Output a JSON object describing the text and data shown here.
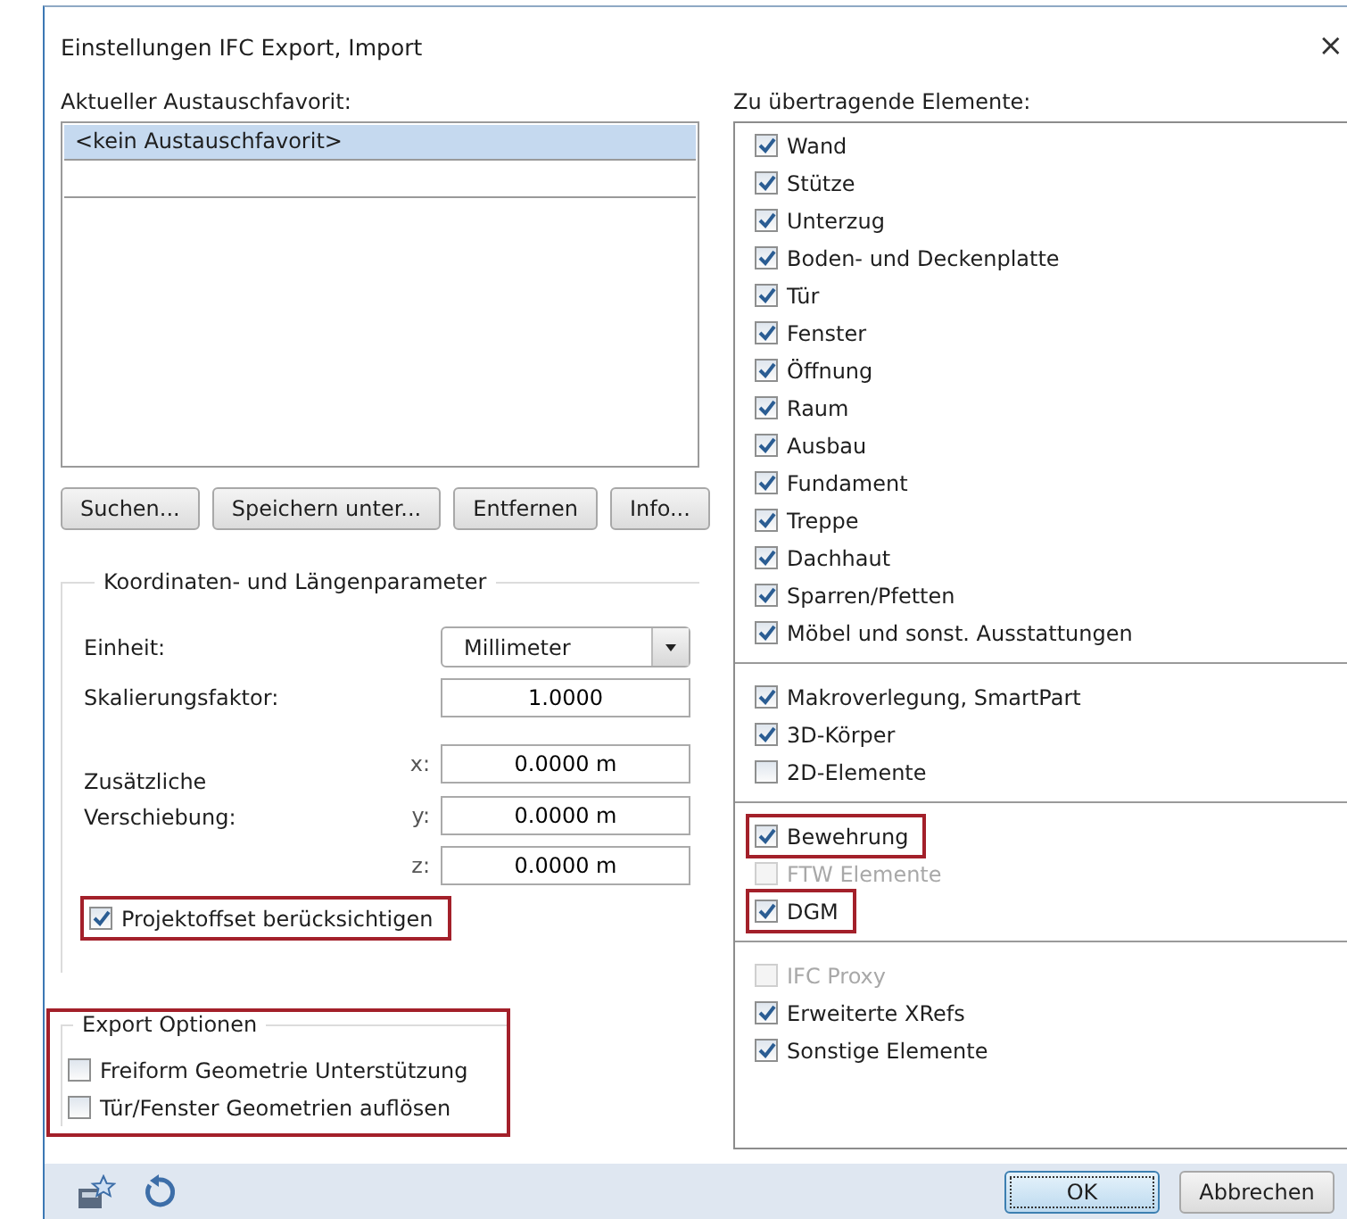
{
  "window": {
    "title": "Einstellungen IFC Export, Import",
    "close": "×"
  },
  "favorites": {
    "label": "Aktueller Austauschfavorit:",
    "items": [
      {
        "label": "<kein Austauschfavorit>",
        "selected": true
      }
    ],
    "buttons": [
      "Suchen...",
      "Speichern unter...",
      "Entfernen",
      "Info..."
    ]
  },
  "coordinates": {
    "legend": "Koordinaten- und Längenparameter",
    "unit": {
      "label": "Einheit:",
      "value": "Millimeter"
    },
    "scale": {
      "label": "Skalierungsfaktor:",
      "value": "1.0000"
    },
    "offset": {
      "label": "Zusätzliche Verschiebung:",
      "fields": [
        {
          "axis": "x:",
          "value": "0.0000 m"
        },
        {
          "axis": "y:",
          "value": "0.0000 m"
        },
        {
          "axis": "z:",
          "value": "0.0000 m"
        }
      ]
    },
    "project_offset": {
      "label": "Projektoffset berücksichtigen",
      "checked": true,
      "highlighted": true
    }
  },
  "export_options": {
    "legend": "Export Optionen",
    "highlighted": true,
    "items": [
      {
        "label": "Freiform Geometrie Unterstützung",
        "checked": false
      },
      {
        "label": "Tür/Fenster Geometrien auflösen",
        "checked": false
      }
    ]
  },
  "elements": {
    "label": "Zu übertragende Elemente:",
    "groups": [
      {
        "items": [
          {
            "label": "Wand",
            "checked": true,
            "disabled": false,
            "highlighted": false
          },
          {
            "label": "Stütze",
            "checked": true,
            "disabled": false,
            "highlighted": false
          },
          {
            "label": "Unterzug",
            "checked": true,
            "disabled": false,
            "highlighted": false
          },
          {
            "label": "Boden- und Deckenplatte",
            "checked": true,
            "disabled": false,
            "highlighted": false
          },
          {
            "label": "Tür",
            "checked": true,
            "disabled": false,
            "highlighted": false
          },
          {
            "label": "Fenster",
            "checked": true,
            "disabled": false,
            "highlighted": false
          },
          {
            "label": "Öffnung",
            "checked": true,
            "disabled": false,
            "highlighted": false
          },
          {
            "label": "Raum",
            "checked": true,
            "disabled": false,
            "highlighted": false
          },
          {
            "label": "Ausbau",
            "checked": true,
            "disabled": false,
            "highlighted": false
          },
          {
            "label": "Fundament",
            "checked": true,
            "disabled": false,
            "highlighted": false
          },
          {
            "label": "Treppe",
            "checked": true,
            "disabled": false,
            "highlighted": false
          },
          {
            "label": "Dachhaut",
            "checked": true,
            "disabled": false,
            "highlighted": false
          },
          {
            "label": "Sparren/Pfetten",
            "checked": true,
            "disabled": false,
            "highlighted": false
          },
          {
            "label": "Möbel und sonst. Ausstattungen",
            "checked": true,
            "disabled": false,
            "highlighted": false
          }
        ]
      },
      {
        "items": [
          {
            "label": "Makroverlegung, SmartPart",
            "checked": true,
            "disabled": false,
            "highlighted": false
          },
          {
            "label": "3D-Körper",
            "checked": true,
            "disabled": false,
            "highlighted": false
          },
          {
            "label": "2D-Elemente",
            "checked": false,
            "disabled": false,
            "highlighted": false
          }
        ]
      },
      {
        "items": [
          {
            "label": "Bewehrung",
            "checked": true,
            "disabled": false,
            "highlighted": true
          },
          {
            "label": "FTW Elemente",
            "checked": false,
            "disabled": true,
            "highlighted": false
          },
          {
            "label": "DGM",
            "checked": true,
            "disabled": false,
            "highlighted": true
          }
        ]
      },
      {
        "items": [
          {
            "label": "IFC Proxy",
            "checked": false,
            "disabled": true,
            "highlighted": false
          },
          {
            "label": "Erweiterte XRefs",
            "checked": true,
            "disabled": false,
            "highlighted": false
          },
          {
            "label": "Sonstige Elemente",
            "checked": true,
            "disabled": false,
            "highlighted": false
          }
        ]
      }
    ]
  },
  "footer": {
    "buttons": [
      {
        "label": "OK",
        "selected": true
      },
      {
        "label": "Abbrechen",
        "selected": false
      }
    ]
  }
}
